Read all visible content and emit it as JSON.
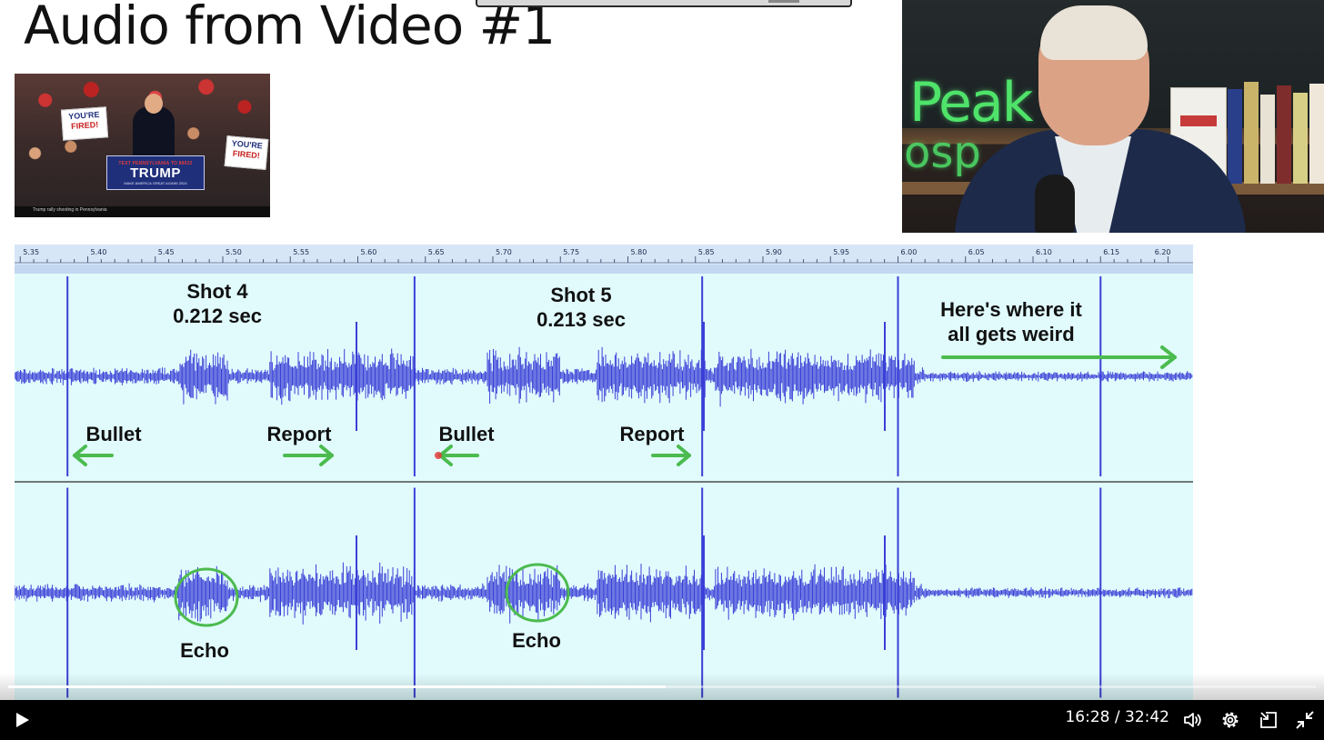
{
  "slide": {
    "title": "Audio from Video #1",
    "thumbnail": {
      "sign_left": [
        "YOU'RE",
        "FIRED!"
      ],
      "sign_right": [
        "YOU'RE",
        "FIRED!"
      ],
      "podium_small": "TEXT PENNSYLVANIA TO 88022",
      "podium_big": "TRUMP",
      "podium_tiny": "MAKE AMERICA GREAT AGAIN! 2024",
      "caption": "Trump rally shooting in Pennsylvania"
    },
    "webcam": {
      "neon_line1": "Peak",
      "neon_line2": "osp"
    },
    "waveform": {
      "time_ticks": [
        "5.35",
        "5.40",
        "5.45",
        "5.50",
        "5.55",
        "5.60",
        "5.65",
        "5.70",
        "5.75",
        "5.80",
        "5.85",
        "5.90",
        "5.95",
        "6.00",
        "6.05",
        "6.10",
        "6.15",
        "6.20"
      ],
      "tick_start": 5.35,
      "tick_end": 6.2,
      "annotations": {
        "shot4_label": "Shot 4",
        "shot4_time": "0.212 sec",
        "shot5_label": "Shot 5",
        "shot5_time": "0.213 sec",
        "weird_line1": "Here's where it",
        "weird_line2": "all gets weird",
        "bullet1": "Bullet",
        "report1": "Report",
        "bullet2": "Bullet",
        "report2": "Report",
        "echo1": "Echo",
        "echo2": "Echo"
      },
      "spike_times": [
        5.385,
        5.642,
        5.855,
        6.0,
        6.15
      ],
      "colors": {
        "background": "#e1fbfd",
        "wave": "#3a3fd6",
        "annotation_green": "#4cbb4f",
        "ruler": "#cfe0f3"
      }
    }
  },
  "player": {
    "current_time": "16:28",
    "separator": " / ",
    "duration": "32:42",
    "progress_fraction": 0.503,
    "icons": [
      "play-icon",
      "volume-icon",
      "settings-icon",
      "miniplayer-icon",
      "exit-fullscreen-icon"
    ]
  }
}
